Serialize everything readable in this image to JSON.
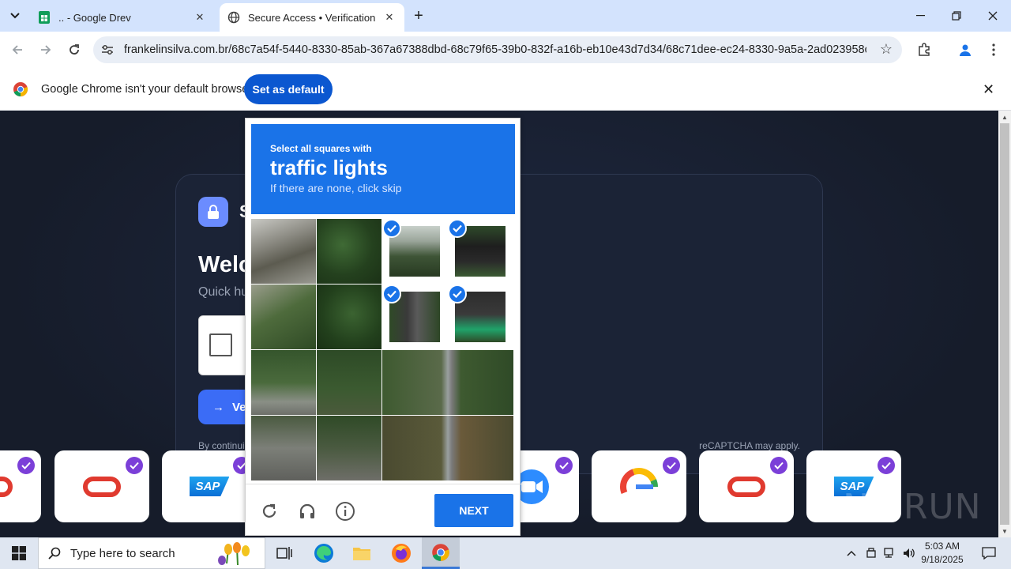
{
  "browser": {
    "tabs": [
      {
        "title": ".. - Google Drev",
        "active": false,
        "favicon": "google-sheets-icon"
      },
      {
        "title": "Secure Access • Verification",
        "active": true,
        "favicon": "globe-icon"
      }
    ],
    "url": "frankelinsilva.com.br/68c7a54f-5440-8330-85ab-367a67388dbd-68c79f65-39b0-832f-a16b-eb10e43d7d34/68c71dee-ec24-8330-9a5a-2ad023958c28-...",
    "infobar": {
      "message": "Google Chrome isn't your default browser",
      "button": "Set as default"
    }
  },
  "page": {
    "brand_partial": "S",
    "welcome_partial": "Welc",
    "subtitle_partial": "Quick hu",
    "verify_partial": "Ve",
    "footer_left_partial": "By continui",
    "footer_right": "reCAPTCHA may apply.",
    "watermark": "ANY RUN",
    "logos": [
      "oracle",
      "oracle",
      "sap",
      "zoom",
      "google",
      "oracle",
      "sap"
    ]
  },
  "captcha": {
    "instruction": "Select all squares with",
    "target": "traffic lights",
    "hint": "If there are none, click skip",
    "selected_count": 4,
    "next_label": "NEXT"
  },
  "taskbar": {
    "search_placeholder": "Type here to search",
    "time": "5:03 AM",
    "date": "9/18/2025"
  },
  "colors": {
    "chrome_tabstrip": "#d3e3fd",
    "captcha_blue": "#1a73e8",
    "page_bg": "#1a2233",
    "badge_purple": "#7b3fd8"
  }
}
